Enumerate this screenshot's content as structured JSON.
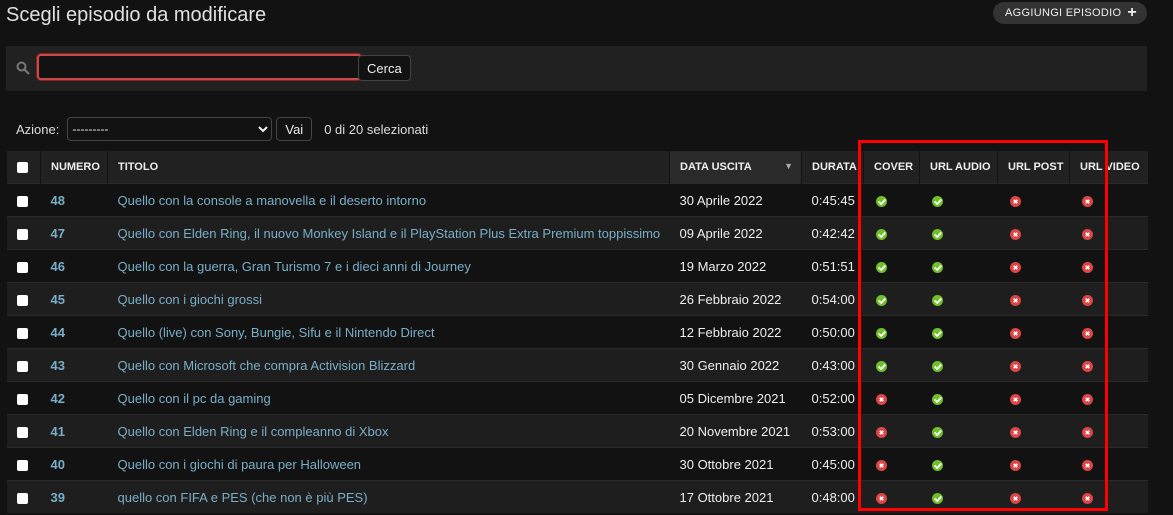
{
  "header": {
    "title": "Scegli episodio da modificare",
    "add_button": "AGGIUNGI EPISODIO"
  },
  "search": {
    "value": "",
    "button": "Cerca"
  },
  "actions": {
    "label": "Azione:",
    "selected": "---------",
    "go": "Vai",
    "selection_count": "0 di 20 selezionati"
  },
  "columns": [
    "NUMERO",
    "TITOLO",
    "DATA USCITA",
    "DURATA",
    "COVER",
    "URL AUDIO",
    "URL POST",
    "URL VIDEO"
  ],
  "status_colors": {
    "yes": "#70bf2b",
    "no": "#dd4646"
  },
  "rows": [
    {
      "numero": "48",
      "titolo": "Quello con la console a manovella e il deserto intorno",
      "data": "30 Aprile 2022",
      "durata": "0:45:45",
      "cover": true,
      "audio": true,
      "post": false,
      "video": false
    },
    {
      "numero": "47",
      "titolo": "Quello con Elden Ring, il nuovo Monkey Island e il PlayStation Plus Extra Premium toppissimo",
      "data": "09 Aprile 2022",
      "durata": "0:42:42",
      "cover": true,
      "audio": true,
      "post": false,
      "video": false
    },
    {
      "numero": "46",
      "titolo": "Quello con la guerra, Gran Turismo 7 e i dieci anni di Journey",
      "data": "19 Marzo 2022",
      "durata": "0:51:51",
      "cover": true,
      "audio": true,
      "post": false,
      "video": false
    },
    {
      "numero": "45",
      "titolo": "Quello con i giochi grossi",
      "data": "26 Febbraio 2022",
      "durata": "0:54:00",
      "cover": true,
      "audio": true,
      "post": false,
      "video": false
    },
    {
      "numero": "44",
      "titolo": "Quello (live) con Sony, Bungie, Sifu e il Nintendo Direct",
      "data": "12 Febbraio 2022",
      "durata": "0:50:00",
      "cover": true,
      "audio": true,
      "post": false,
      "video": false
    },
    {
      "numero": "43",
      "titolo": "Quello con Microsoft che compra Activision Blizzard",
      "data": "30 Gennaio 2022",
      "durata": "0:43:00",
      "cover": true,
      "audio": true,
      "post": false,
      "video": false
    },
    {
      "numero": "42",
      "titolo": "Quello con il pc da gaming",
      "data": "05 Dicembre 2021",
      "durata": "0:52:00",
      "cover": false,
      "audio": true,
      "post": false,
      "video": false
    },
    {
      "numero": "41",
      "titolo": "Quello con Elden Ring e il compleanno di Xbox",
      "data": "20 Novembre 2021",
      "durata": "0:53:00",
      "cover": false,
      "audio": true,
      "post": false,
      "video": false
    },
    {
      "numero": "40",
      "titolo": "Quello con i giochi di paura per Halloween",
      "data": "30 Ottobre 2021",
      "durata": "0:45:00",
      "cover": false,
      "audio": true,
      "post": false,
      "video": false
    },
    {
      "numero": "39",
      "titolo": "quello con FIFA e PES (che non è più PES)",
      "data": "17 Ottobre 2021",
      "durata": "0:48:00",
      "cover": false,
      "audio": true,
      "post": false,
      "video": false
    }
  ]
}
